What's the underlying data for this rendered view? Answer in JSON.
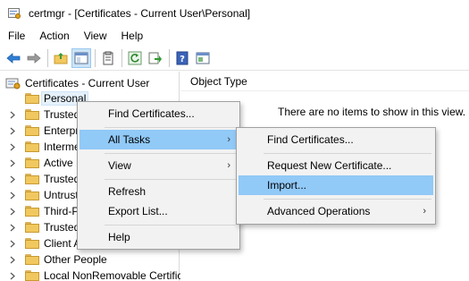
{
  "window": {
    "title": "certmgr - [Certificates - Current User\\Personal]"
  },
  "menu": [
    "File",
    "Action",
    "View",
    "Help"
  ],
  "toolbar": {
    "icons": [
      "back-arrow-icon",
      "forward-arrow-icon",
      "up-folder-icon",
      "show-hide-tree-icon",
      "properties-icon",
      "refresh-icon",
      "export-list-icon",
      "help-icon",
      "console-icon"
    ]
  },
  "tree": {
    "root": "Certificates - Current User",
    "items": [
      {
        "label": "Personal",
        "selected": true,
        "expandable": false
      },
      {
        "label": "Trusted",
        "expandable": true
      },
      {
        "label": "Enterpr",
        "expandable": true
      },
      {
        "label": "Interme",
        "expandable": true
      },
      {
        "label": "Active D",
        "expandable": true
      },
      {
        "label": "Trusted",
        "expandable": true
      },
      {
        "label": "Untrust",
        "expandable": true
      },
      {
        "label": "Third-P",
        "expandable": true
      },
      {
        "label": "Trusted",
        "expandable": true
      },
      {
        "label": "Client A",
        "expandable": true
      },
      {
        "label": "Other People",
        "expandable": true
      },
      {
        "label": "Local NonRemovable Certific",
        "expandable": true
      }
    ]
  },
  "right": {
    "header": "Object Type",
    "empty_message": "There are no items to show in this view."
  },
  "context_menu": {
    "items": [
      {
        "label": "Find Certificates...",
        "submenu": false
      },
      {
        "label": "All Tasks",
        "submenu": true,
        "highlighted": true
      },
      {
        "label": "View",
        "submenu": true
      },
      {
        "label": "Refresh",
        "submenu": false
      },
      {
        "label": "Export List...",
        "submenu": false
      },
      {
        "label": "Help",
        "submenu": false
      }
    ]
  },
  "submenu": {
    "items": [
      {
        "label": "Find Certificates...",
        "submenu": false
      },
      {
        "label": "Request New Certificate...",
        "submenu": false
      },
      {
        "label": "Import...",
        "submenu": false,
        "highlighted": true
      },
      {
        "label": "Advanced Operations",
        "submenu": true
      }
    ]
  },
  "glyphs": {
    "submenu_arrow": "›",
    "expand_arrow": "›"
  },
  "colors": {
    "highlight": "#91c9f7",
    "menu_bg": "#f2f2f2",
    "selection": "#e5f1fb",
    "folder": "#f1c85f"
  }
}
